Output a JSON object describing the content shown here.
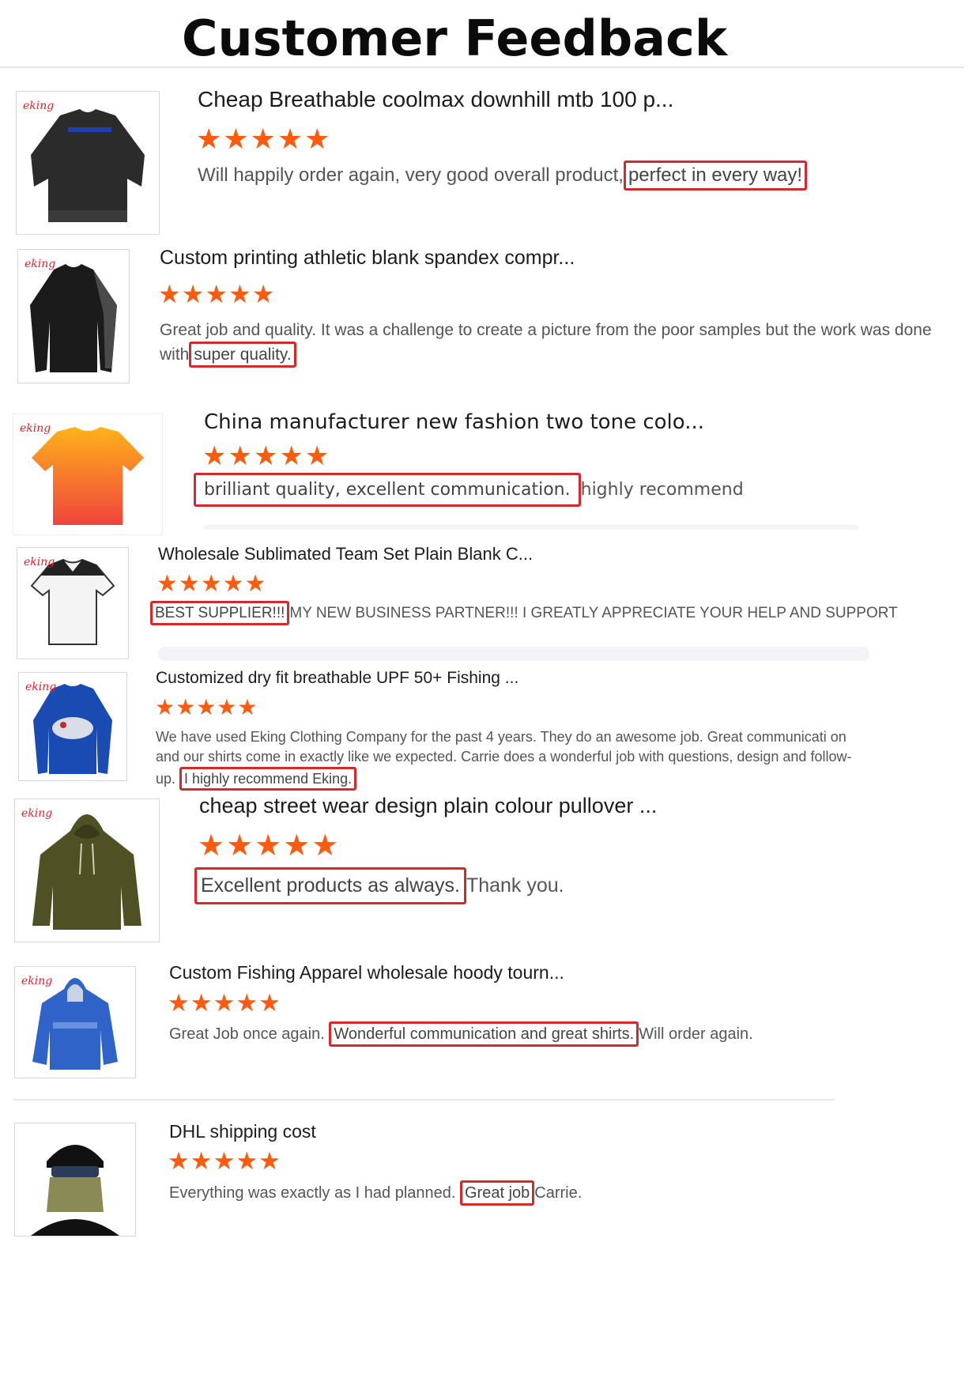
{
  "page_title": "Customer Feedback",
  "colors": {
    "star": "#ff5b0f",
    "highlight_border": "#d32a2a",
    "brand_mark": "#e0242d"
  },
  "reviews": [
    {
      "thumb_icon": "black-mtb-jersey-icon",
      "brand": "eking",
      "title": "Cheap Breathable coolmax downhill mtb 100 p...",
      "stars": "★★★★★",
      "rating": 5,
      "before": "Will happily order again, very good overall product,",
      "highlight": "perfect in every way!",
      "after": ""
    },
    {
      "thumb_icon": "black-compression-shirt-icon",
      "brand": "eking",
      "title": "Custom printing athletic blank spandex compr...",
      "stars": "★★★★★",
      "rating": 5,
      "before": "Great job and quality. It was a challenge to create a picture from the poor samples but the work was done with",
      "highlight": "super quality.",
      "after": ""
    },
    {
      "thumb_icon": "orange-gradient-tshirt-icon",
      "brand": "eking",
      "title": "China manufacturer new fashion two tone colo...",
      "stars": "★★★★★",
      "rating": 5,
      "before": "",
      "highlight": "brilliant quality, excellent communication.",
      "after": "highly recommend"
    },
    {
      "thumb_icon": "white-rugby-jersey-icon",
      "brand": "eking",
      "title": "Wholesale Sublimated Team Set Plain Blank C...",
      "stars": "★★★★★",
      "rating": 5,
      "before": "",
      "highlight": "BEST SUPPLIER!!!",
      "after": "MY NEW BUSINESS PARTNER!!! I GREATLY APPRECIATE YOUR HELP AND SUPPORT"
    },
    {
      "thumb_icon": "blue-fishing-shirt-icon",
      "brand": "eking",
      "title": "Customized dry fit breathable UPF 50+ Fishing ...",
      "stars": "★★★★★",
      "rating": 5,
      "before": "We have used Eking Clothing Company for the past 4 years.  They do an awesome job.  Great communicati on and our shirts come in exactly like we expected.  Carrie does a wonderful job with questions, design and follow-up.",
      "highlight": "I highly recommend Eking.",
      "after": ""
    },
    {
      "thumb_icon": "olive-hoodie-icon",
      "brand": "eking",
      "title": "cheap street wear design plain colour pullover ...",
      "stars": "★★★★★",
      "rating": 5,
      "before": "",
      "highlight": "Excellent products as always.",
      "after": "Thank you."
    },
    {
      "thumb_icon": "blue-fishing-hoody-icon",
      "brand": "eking",
      "title": "Custom Fishing Apparel wholesale hoody tourn...",
      "stars": "★★★★★",
      "rating": 5,
      "before": "Great Job once again.",
      "highlight": "Wonderful communication and great shirts.",
      "after": "Will order again."
    },
    {
      "thumb_icon": "face-mask-man-icon",
      "brand": "",
      "title": "DHL shipping cost",
      "stars": "★★★★★",
      "rating": 5,
      "before": "Everything was exactly as I had planned.",
      "highlight": "Great job",
      "after": "Carrie."
    }
  ]
}
